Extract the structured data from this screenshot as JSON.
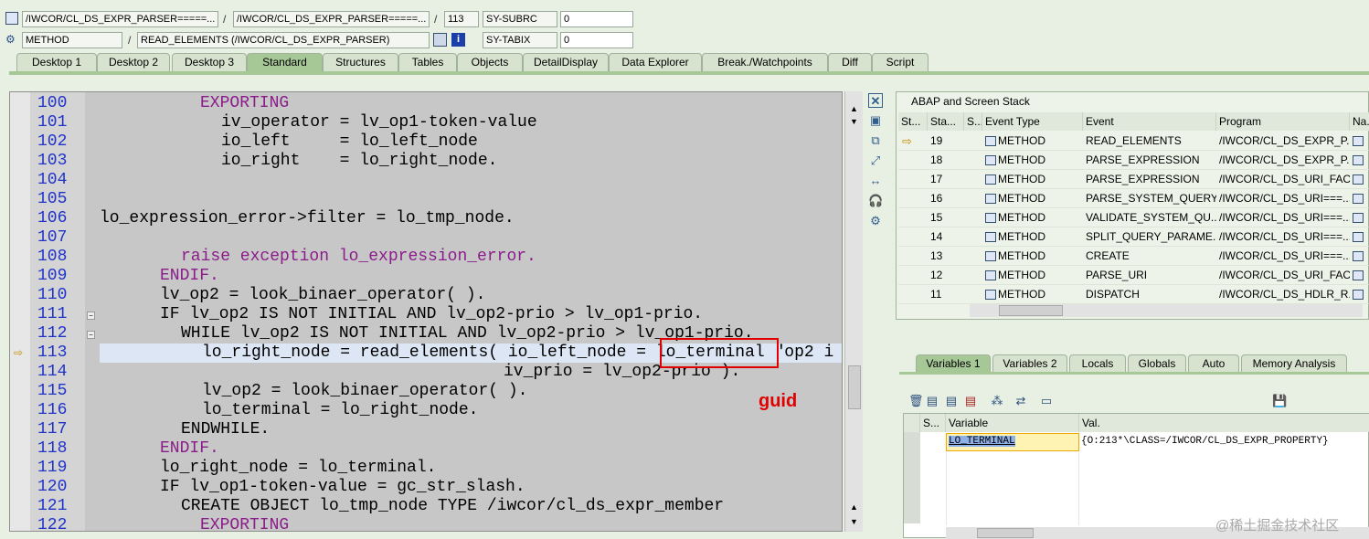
{
  "header": {
    "row1": {
      "program_left": "/IWCOR/CL_DS_EXPR_PARSER=====...",
      "program_right": "/IWCOR/CL_DS_EXPR_PARSER=====...",
      "line": "113",
      "sys_field": "SY-SUBRC",
      "sys_value": "0"
    },
    "row2": {
      "type": "METHOD",
      "event": "READ_ELEMENTS (/IWCOR/CL_DS_EXPR_PARSER)",
      "sys_field": "SY-TABIX",
      "sys_value": "0"
    }
  },
  "tabs": [
    "Desktop 1",
    "Desktop 2",
    "Desktop 3",
    "Standard",
    "Structures",
    "Tables",
    "Objects",
    "DetailDisplay",
    "Data Explorer",
    "Break./Watchpoints",
    "Diff",
    "Script"
  ],
  "code": {
    "lines": [
      {
        "no": "100",
        "text": "EXPORTING"
      },
      {
        "no": "101",
        "text": "iv_operator = lv_op1-token-value"
      },
      {
        "no": "102",
        "text": "io_left     = lo_left_node"
      },
      {
        "no": "103",
        "text": "io_right    = lo_right_node."
      },
      {
        "no": "104",
        "text": ""
      },
      {
        "no": "105",
        "text": ""
      },
      {
        "no": "106",
        "text": "lo_expression_error->filter = lo_tmp_node."
      },
      {
        "no": "107",
        "text": ""
      },
      {
        "no": "108",
        "text": "raise exception lo_expression_error."
      },
      {
        "no": "109",
        "text": "ENDIF."
      },
      {
        "no": "110",
        "text": "lv_op2 = look_binaer_operator( )."
      },
      {
        "no": "111",
        "text": "IF lv_op2 IS NOT INITIAL AND lv_op2-prio > lv_op1-prio."
      },
      {
        "no": "112",
        "text": "WHILE lv_op2 IS NOT INITIAL AND lv_op2-prio > lv_op1-prio."
      },
      {
        "no": "113",
        "text": "lo_right_node = read_elements( io_left_node = lo_terminal \"op2 i"
      },
      {
        "no": "114",
        "text": "iv_prio = lv_op2-prio )."
      },
      {
        "no": "115",
        "text": "lv_op2 = look_binaer_operator( )."
      },
      {
        "no": "116",
        "text": "lo_terminal = lo_right_node."
      },
      {
        "no": "117",
        "text": "ENDWHILE."
      },
      {
        "no": "118",
        "text": "ENDIF."
      },
      {
        "no": "119",
        "text": "lo_right_node = lo_terminal."
      },
      {
        "no": "120",
        "text": "IF lv_op1-token-value = gc_str_slash."
      },
      {
        "no": "121",
        "text": "CREATE OBJECT lo_tmp_node TYPE /iwcor/cl_ds_expr_member"
      },
      {
        "no": "122",
        "text": "EXPORTING"
      }
    ],
    "annotation": "guid"
  },
  "stack": {
    "title": "ABAP and Screen Stack",
    "columns": [
      "St...",
      "Sta...",
      "S...",
      "Event Type",
      "Event",
      "Program",
      "Na..."
    ],
    "rows": [
      {
        "level": "19",
        "type": "METHOD",
        "event": "READ_ELEMENTS",
        "program": "/IWCOR/CL_DS_EXPR_P..."
      },
      {
        "level": "18",
        "type": "METHOD",
        "event": "PARSE_EXPRESSION",
        "program": "/IWCOR/CL_DS_EXPR_P..."
      },
      {
        "level": "17",
        "type": "METHOD",
        "event": "PARSE_EXPRESSION",
        "program": "/IWCOR/CL_DS_URI_FAC..."
      },
      {
        "level": "16",
        "type": "METHOD",
        "event": "PARSE_SYSTEM_QUERY...",
        "program": "/IWCOR/CL_DS_URI===..."
      },
      {
        "level": "15",
        "type": "METHOD",
        "event": "VALIDATE_SYSTEM_QU...",
        "program": "/IWCOR/CL_DS_URI===..."
      },
      {
        "level": "14",
        "type": "METHOD",
        "event": "SPLIT_QUERY_PARAME...",
        "program": "/IWCOR/CL_DS_URI===..."
      },
      {
        "level": "13",
        "type": "METHOD",
        "event": "CREATE",
        "program": "/IWCOR/CL_DS_URI===..."
      },
      {
        "level": "12",
        "type": "METHOD",
        "event": "PARSE_URI",
        "program": "/IWCOR/CL_DS_URI_FAC..."
      },
      {
        "level": "11",
        "type": "METHOD",
        "event": "DISPATCH",
        "program": "/IWCOR/CL_DS_HDLR_R..."
      }
    ]
  },
  "variables": {
    "tabs": [
      "Variables 1",
      "Variables 2",
      "Locals",
      "Globals",
      "Auto",
      "Memory Analysis"
    ],
    "columns": [
      "S...",
      "Variable",
      "Val."
    ],
    "rows": [
      {
        "name": "LO_TERMINAL",
        "value": "{O:213*\\CLASS=/IWCOR/CL_DS_EXPR_PROPERTY}"
      }
    ]
  },
  "watermark": "@稀土掘金技术社区"
}
